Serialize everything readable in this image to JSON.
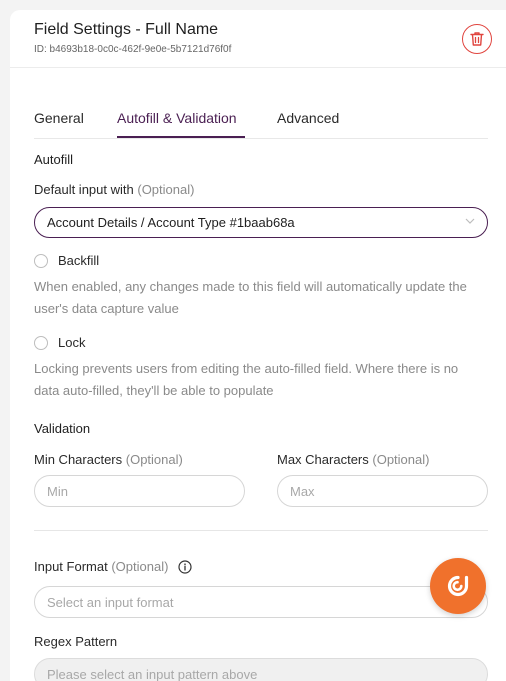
{
  "header": {
    "title": "Field Settings - Full Name",
    "id_text": "ID: b4693b18-0c0c-462f-9e0e-5b7121d76f0f",
    "delete_icon": "trash-icon"
  },
  "tabs": [
    {
      "label": "General",
      "active": false
    },
    {
      "label": "Autofill & Validation",
      "active": true
    },
    {
      "label": "Advanced",
      "active": false
    }
  ],
  "autofill": {
    "section_title": "Autofill",
    "default_input_label": "Default input with",
    "optional_text": "(Optional)",
    "default_input_value": "Account Details / Account Type #1baab68a",
    "backfill_label": "Backfill",
    "backfill_help": "When enabled, any changes made to this field will automatically update the user's data capture value",
    "lock_label": "Lock",
    "lock_help": "Locking prevents users from editing the auto-filled field. Where there is no data auto-filled, they'll be able to populate"
  },
  "validation": {
    "section_title": "Validation",
    "min_label": "Min Characters",
    "min_optional": "(Optional)",
    "min_placeholder": "Min",
    "max_label": "Max Characters",
    "max_optional": "(Optional)",
    "max_placeholder": "Max",
    "input_format_label": "Input Format",
    "input_format_optional": "(Optional)",
    "input_format_placeholder": "Select an input format",
    "regex_label": "Regex Pattern",
    "regex_placeholder": "Please select an input pattern above"
  },
  "colors": {
    "accent": "#4a1f52",
    "danger": "#e0443e",
    "fab": "#f0712c"
  }
}
